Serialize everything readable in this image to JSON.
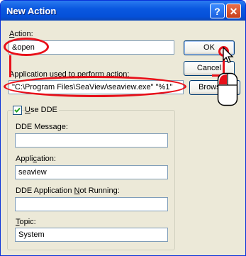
{
  "window": {
    "title": "New Action"
  },
  "titlebar_buttons": {
    "help": "?",
    "close": "✕"
  },
  "action": {
    "label_prefix": "",
    "label_u": "A",
    "label_rest": "ction:",
    "value": "&open"
  },
  "application_path": {
    "label": "Application used to perform action:",
    "value": "\"C:\\Program Files\\SeaView\\seaview.exe\" \"%1\""
  },
  "buttons": {
    "ok": "OK",
    "cancel": "Cancel",
    "browse": "Browse..."
  },
  "use_dde": {
    "label_u": "U",
    "label_rest": "se DDE",
    "checked": true
  },
  "dde_message": {
    "label": "DDE Message:",
    "value": ""
  },
  "application": {
    "label_prefix": "Appli",
    "label_u": "c",
    "label_rest": "ation:",
    "value": "seaview"
  },
  "dde_app_not_running": {
    "label_prefix": "DDE Application ",
    "label_u": "N",
    "label_rest": "ot Running:",
    "value": ""
  },
  "topic": {
    "label_u": "T",
    "label_rest": "opic:",
    "value": "System"
  },
  "colors": {
    "highlight": "#e8101a",
    "titlebar": "#0550d8",
    "dialog_bg": "#ece9d8"
  }
}
